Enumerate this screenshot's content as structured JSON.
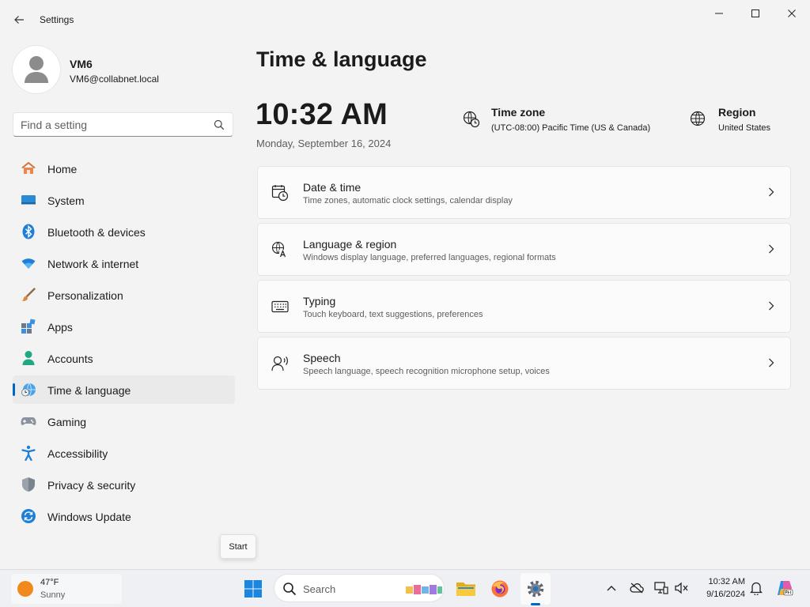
{
  "window": {
    "title": "Settings",
    "controls": {
      "minimize": "minimize-icon",
      "maximize": "maximize-icon",
      "close": "close-icon"
    }
  },
  "profile": {
    "name": "VM6",
    "email": "VM6@collabnet.local"
  },
  "search": {
    "placeholder": "Find a setting"
  },
  "sidebar": {
    "items": [
      {
        "label": "Home",
        "icon": "home-icon"
      },
      {
        "label": "System",
        "icon": "system-icon"
      },
      {
        "label": "Bluetooth & devices",
        "icon": "bluetooth-icon"
      },
      {
        "label": "Network & internet",
        "icon": "network-icon"
      },
      {
        "label": "Personalization",
        "icon": "brush-icon"
      },
      {
        "label": "Apps",
        "icon": "apps-icon"
      },
      {
        "label": "Accounts",
        "icon": "accounts-icon"
      },
      {
        "label": "Time & language",
        "icon": "time-language-icon",
        "active": true
      },
      {
        "label": "Gaming",
        "icon": "gamepad-icon"
      },
      {
        "label": "Accessibility",
        "icon": "accessibility-icon"
      },
      {
        "label": "Privacy & security",
        "icon": "shield-icon"
      },
      {
        "label": "Windows Update",
        "icon": "update-icon"
      }
    ]
  },
  "tooltip": {
    "text": "Start"
  },
  "main": {
    "title": "Time & language",
    "time": "10:32 AM",
    "date": "Monday, September 16, 2024",
    "timezone": {
      "title": "Time zone",
      "value": "(UTC-08:00) Pacific Time (US & Canada)"
    },
    "region": {
      "title": "Region",
      "value": "United States"
    },
    "cards": [
      {
        "title": "Date & time",
        "subtitle": "Time zones, automatic clock settings, calendar display",
        "icon": "calendar-clock-icon"
      },
      {
        "title": "Language & region",
        "subtitle": "Windows display language, preferred languages, regional formats",
        "icon": "language-icon"
      },
      {
        "title": "Typing",
        "subtitle": "Touch keyboard, text suggestions, preferences",
        "icon": "keyboard-icon"
      },
      {
        "title": "Speech",
        "subtitle": "Speech language, speech recognition microphone setup, voices",
        "icon": "speech-icon"
      }
    ]
  },
  "taskbar": {
    "weather": {
      "temp": "47°F",
      "condition": "Sunny"
    },
    "search_label": "Search",
    "clock": {
      "time": "10:32 AM",
      "date": "9/16/2024"
    }
  },
  "colors": {
    "accent": "#0067c0",
    "background": "#f3f3f3",
    "card": "#fbfbfb"
  }
}
